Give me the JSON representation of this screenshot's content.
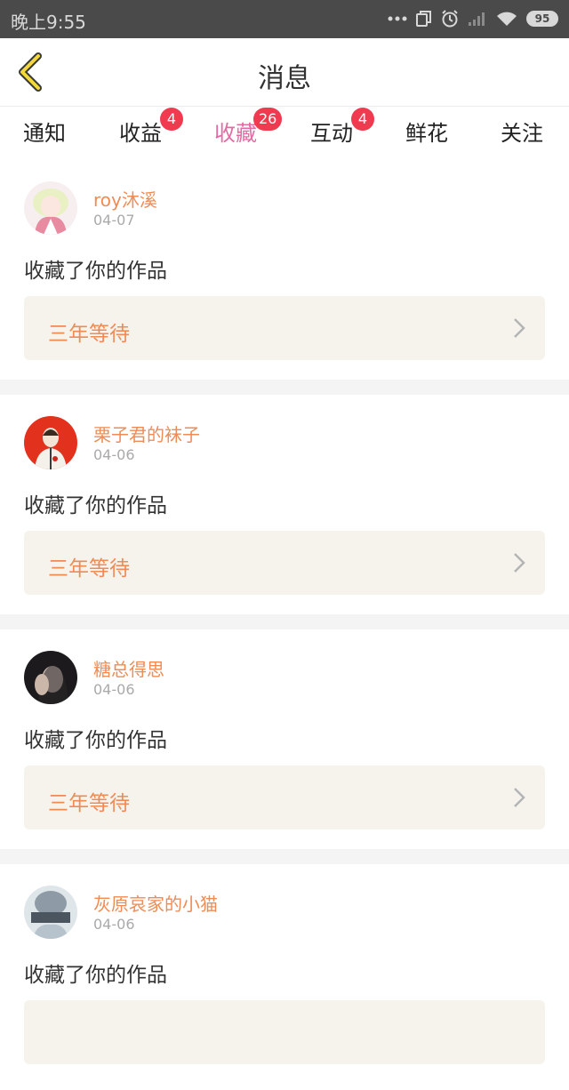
{
  "status_bar": {
    "time": "晚上9:55",
    "battery": "95",
    "icons": [
      "more-dots-icon",
      "copy-icon",
      "alarm-icon",
      "signal-icon",
      "wifi-icon",
      "battery-icon"
    ]
  },
  "header": {
    "title": "消息",
    "back_icon": "back-chevron-icon"
  },
  "tabs": [
    {
      "label": "通知",
      "badge": ""
    },
    {
      "label": "收益",
      "badge": "4"
    },
    {
      "label": "收藏",
      "badge": "26",
      "active": true
    },
    {
      "label": "互动",
      "badge": "4"
    },
    {
      "label": "鲜花",
      "badge": ""
    },
    {
      "label": "关注",
      "badge": ""
    }
  ],
  "messages": [
    {
      "username": "roy沐溪",
      "date": "04-07",
      "action": "收藏了你的作品",
      "work_title": "三年等待"
    },
    {
      "username": "栗子君的袜子",
      "date": "04-06",
      "action": "收藏了你的作品",
      "work_title": "三年等待"
    },
    {
      "username": "糖总得思",
      "date": "04-06",
      "action": "收藏了你的作品",
      "work_title": "三年等待"
    },
    {
      "username": "灰原哀家的小猫",
      "date": "04-06",
      "action": "收藏了你的作品",
      "work_title": ""
    }
  ],
  "colors": {
    "accent_pink": "#e36aa3",
    "username_orange": "#ef8c55",
    "badge_red": "#f03a50",
    "back_chevron_yellow": "#f5d93a",
    "work_bg": "#f5f3ec",
    "status_bar_bg": "#4a4a4a"
  }
}
